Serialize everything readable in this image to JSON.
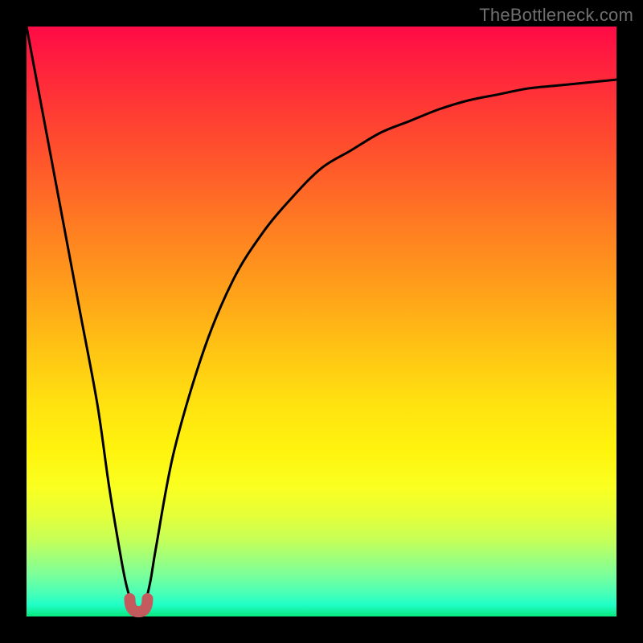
{
  "watermark": "TheBottleneck.com",
  "colors": {
    "frame": "#000000",
    "curve": "#000000",
    "marker": "#c35a5e",
    "watermark": "#6f6f6f"
  },
  "chart_data": {
    "type": "line",
    "title": "",
    "xlabel": "",
    "ylabel": "",
    "xlim": [
      0,
      100
    ],
    "ylim": [
      0,
      100
    ],
    "grid": false,
    "legend": false,
    "series": [
      {
        "name": "bottleneck-curve",
        "x": [
          0,
          3,
          6,
          9,
          12,
          14,
          16,
          17,
          18,
          19,
          20,
          21,
          22,
          25,
          30,
          35,
          40,
          45,
          50,
          55,
          60,
          65,
          70,
          75,
          80,
          85,
          90,
          95,
          100
        ],
        "y": [
          100,
          84,
          68,
          52,
          36,
          22,
          10,
          5,
          2,
          1,
          2,
          6,
          12,
          28,
          45,
          57,
          65,
          71,
          76,
          79,
          82,
          84,
          86,
          87.5,
          88.5,
          89.5,
          90,
          90.5,
          91
        ]
      }
    ],
    "optimal_range": {
      "x_start": 17.5,
      "x_end": 20.5,
      "y_min": 0.8,
      "y_max": 3
    }
  }
}
